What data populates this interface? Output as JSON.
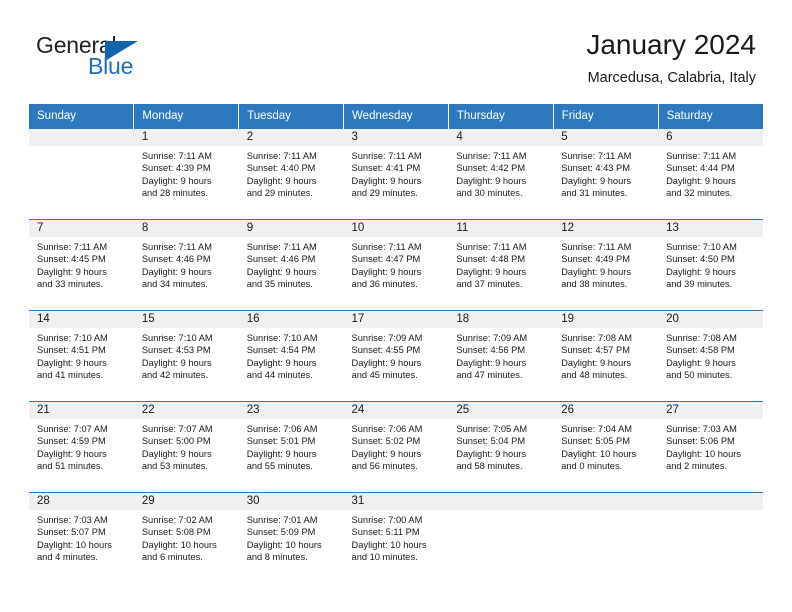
{
  "logo": {
    "word1": "General",
    "word2": "Blue",
    "triangle_color": "#1363ab",
    "word1_color": "#231f20",
    "word2_color": "#1f6db5"
  },
  "header": {
    "title": "January 2024",
    "subtitle": "Marcedusa, Calabria, Italy"
  },
  "theme": {
    "header_bg": "#2e79bd",
    "daynum_bg": "#f0f0f0",
    "row_border": "#2e79bd"
  },
  "weekday_headers": [
    "Sunday",
    "Monday",
    "Tuesday",
    "Wednesday",
    "Thursday",
    "Friday",
    "Saturday"
  ],
  "labels": {
    "sunrise_prefix": "Sunrise: ",
    "sunset_prefix": "Sunset: ",
    "daylight_prefix": "Daylight: "
  },
  "weeks": [
    [
      {
        "day": "",
        "empty": true
      },
      {
        "day": "1",
        "sunrise": "Sunrise: 7:11 AM",
        "sunset": "Sunset: 4:39 PM",
        "daylight1": "Daylight: 9 hours",
        "daylight2": "and 28 minutes."
      },
      {
        "day": "2",
        "sunrise": "Sunrise: 7:11 AM",
        "sunset": "Sunset: 4:40 PM",
        "daylight1": "Daylight: 9 hours",
        "daylight2": "and 29 minutes."
      },
      {
        "day": "3",
        "sunrise": "Sunrise: 7:11 AM",
        "sunset": "Sunset: 4:41 PM",
        "daylight1": "Daylight: 9 hours",
        "daylight2": "and 29 minutes."
      },
      {
        "day": "4",
        "sunrise": "Sunrise: 7:11 AM",
        "sunset": "Sunset: 4:42 PM",
        "daylight1": "Daylight: 9 hours",
        "daylight2": "and 30 minutes."
      },
      {
        "day": "5",
        "sunrise": "Sunrise: 7:11 AM",
        "sunset": "Sunset: 4:43 PM",
        "daylight1": "Daylight: 9 hours",
        "daylight2": "and 31 minutes."
      },
      {
        "day": "6",
        "sunrise": "Sunrise: 7:11 AM",
        "sunset": "Sunset: 4:44 PM",
        "daylight1": "Daylight: 9 hours",
        "daylight2": "and 32 minutes."
      }
    ],
    [
      {
        "day": "7",
        "sunrise": "Sunrise: 7:11 AM",
        "sunset": "Sunset: 4:45 PM",
        "daylight1": "Daylight: 9 hours",
        "daylight2": "and 33 minutes."
      },
      {
        "day": "8",
        "sunrise": "Sunrise: 7:11 AM",
        "sunset": "Sunset: 4:46 PM",
        "daylight1": "Daylight: 9 hours",
        "daylight2": "and 34 minutes."
      },
      {
        "day": "9",
        "sunrise": "Sunrise: 7:11 AM",
        "sunset": "Sunset: 4:46 PM",
        "daylight1": "Daylight: 9 hours",
        "daylight2": "and 35 minutes."
      },
      {
        "day": "10",
        "sunrise": "Sunrise: 7:11 AM",
        "sunset": "Sunset: 4:47 PM",
        "daylight1": "Daylight: 9 hours",
        "daylight2": "and 36 minutes."
      },
      {
        "day": "11",
        "sunrise": "Sunrise: 7:11 AM",
        "sunset": "Sunset: 4:48 PM",
        "daylight1": "Daylight: 9 hours",
        "daylight2": "and 37 minutes."
      },
      {
        "day": "12",
        "sunrise": "Sunrise: 7:11 AM",
        "sunset": "Sunset: 4:49 PM",
        "daylight1": "Daylight: 9 hours",
        "daylight2": "and 38 minutes."
      },
      {
        "day": "13",
        "sunrise": "Sunrise: 7:10 AM",
        "sunset": "Sunset: 4:50 PM",
        "daylight1": "Daylight: 9 hours",
        "daylight2": "and 39 minutes."
      }
    ],
    [
      {
        "day": "14",
        "sunrise": "Sunrise: 7:10 AM",
        "sunset": "Sunset: 4:51 PM",
        "daylight1": "Daylight: 9 hours",
        "daylight2": "and 41 minutes."
      },
      {
        "day": "15",
        "sunrise": "Sunrise: 7:10 AM",
        "sunset": "Sunset: 4:53 PM",
        "daylight1": "Daylight: 9 hours",
        "daylight2": "and 42 minutes."
      },
      {
        "day": "16",
        "sunrise": "Sunrise: 7:10 AM",
        "sunset": "Sunset: 4:54 PM",
        "daylight1": "Daylight: 9 hours",
        "daylight2": "and 44 minutes."
      },
      {
        "day": "17",
        "sunrise": "Sunrise: 7:09 AM",
        "sunset": "Sunset: 4:55 PM",
        "daylight1": "Daylight: 9 hours",
        "daylight2": "and 45 minutes."
      },
      {
        "day": "18",
        "sunrise": "Sunrise: 7:09 AM",
        "sunset": "Sunset: 4:56 PM",
        "daylight1": "Daylight: 9 hours",
        "daylight2": "and 47 minutes."
      },
      {
        "day": "19",
        "sunrise": "Sunrise: 7:08 AM",
        "sunset": "Sunset: 4:57 PM",
        "daylight1": "Daylight: 9 hours",
        "daylight2": "and 48 minutes."
      },
      {
        "day": "20",
        "sunrise": "Sunrise: 7:08 AM",
        "sunset": "Sunset: 4:58 PM",
        "daylight1": "Daylight: 9 hours",
        "daylight2": "and 50 minutes."
      }
    ],
    [
      {
        "day": "21",
        "sunrise": "Sunrise: 7:07 AM",
        "sunset": "Sunset: 4:59 PM",
        "daylight1": "Daylight: 9 hours",
        "daylight2": "and 51 minutes."
      },
      {
        "day": "22",
        "sunrise": "Sunrise: 7:07 AM",
        "sunset": "Sunset: 5:00 PM",
        "daylight1": "Daylight: 9 hours",
        "daylight2": "and 53 minutes."
      },
      {
        "day": "23",
        "sunrise": "Sunrise: 7:06 AM",
        "sunset": "Sunset: 5:01 PM",
        "daylight1": "Daylight: 9 hours",
        "daylight2": "and 55 minutes."
      },
      {
        "day": "24",
        "sunrise": "Sunrise: 7:06 AM",
        "sunset": "Sunset: 5:02 PM",
        "daylight1": "Daylight: 9 hours",
        "daylight2": "and 56 minutes."
      },
      {
        "day": "25",
        "sunrise": "Sunrise: 7:05 AM",
        "sunset": "Sunset: 5:04 PM",
        "daylight1": "Daylight: 9 hours",
        "daylight2": "and 58 minutes."
      },
      {
        "day": "26",
        "sunrise": "Sunrise: 7:04 AM",
        "sunset": "Sunset: 5:05 PM",
        "daylight1": "Daylight: 10 hours",
        "daylight2": "and 0 minutes."
      },
      {
        "day": "27",
        "sunrise": "Sunrise: 7:03 AM",
        "sunset": "Sunset: 5:06 PM",
        "daylight1": "Daylight: 10 hours",
        "daylight2": "and 2 minutes."
      }
    ],
    [
      {
        "day": "28",
        "sunrise": "Sunrise: 7:03 AM",
        "sunset": "Sunset: 5:07 PM",
        "daylight1": "Daylight: 10 hours",
        "daylight2": "and 4 minutes."
      },
      {
        "day": "29",
        "sunrise": "Sunrise: 7:02 AM",
        "sunset": "Sunset: 5:08 PM",
        "daylight1": "Daylight: 10 hours",
        "daylight2": "and 6 minutes."
      },
      {
        "day": "30",
        "sunrise": "Sunrise: 7:01 AM",
        "sunset": "Sunset: 5:09 PM",
        "daylight1": "Daylight: 10 hours",
        "daylight2": "and 8 minutes."
      },
      {
        "day": "31",
        "sunrise": "Sunrise: 7:00 AM",
        "sunset": "Sunset: 5:11 PM",
        "daylight1": "Daylight: 10 hours",
        "daylight2": "and 10 minutes."
      },
      {
        "day": "",
        "empty": true
      },
      {
        "day": "",
        "empty": true
      },
      {
        "day": "",
        "empty": true
      }
    ]
  ]
}
